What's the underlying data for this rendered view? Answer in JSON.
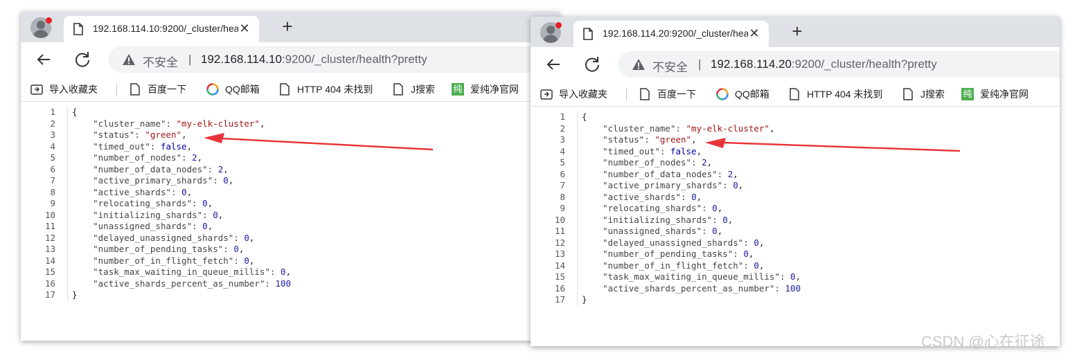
{
  "windows": [
    {
      "tab_title": "192.168.114.10:9200/_cluster/hea",
      "security_label": "不安全",
      "url_host": "192.168.114.10",
      "url_rest": ":9200/_cluster/health?pretty",
      "bookmarks": [
        "导入收藏夹",
        "百度一下",
        "QQ邮箱",
        "HTTP 404 未找到",
        "J搜索",
        "爱纯净官网"
      ],
      "json_lines": [
        {
          "n": "1",
          "pre": "{"
        },
        {
          "n": "2",
          "key": "cluster_name",
          "val": "\"my-elk-cluster\"",
          "vt": "s",
          "tail": ","
        },
        {
          "n": "3",
          "key": "status",
          "val": "\"green\"",
          "vt": "s",
          "tail": ","
        },
        {
          "n": "4",
          "key": "timed_out",
          "val": "false",
          "vt": "b",
          "tail": ","
        },
        {
          "n": "5",
          "key": "number_of_nodes",
          "val": "2",
          "vt": "n",
          "tail": ","
        },
        {
          "n": "6",
          "key": "number_of_data_nodes",
          "val": "2",
          "vt": "n",
          "tail": ","
        },
        {
          "n": "7",
          "key": "active_primary_shards",
          "val": "0",
          "vt": "n",
          "tail": ","
        },
        {
          "n": "8",
          "key": "active_shards",
          "val": "0",
          "vt": "n",
          "tail": ","
        },
        {
          "n": "9",
          "key": "relocating_shards",
          "val": "0",
          "vt": "n",
          "tail": ","
        },
        {
          "n": "10",
          "key": "initializing_shards",
          "val": "0",
          "vt": "n",
          "tail": ","
        },
        {
          "n": "11",
          "key": "unassigned_shards",
          "val": "0",
          "vt": "n",
          "tail": ","
        },
        {
          "n": "12",
          "key": "delayed_unassigned_shards",
          "val": "0",
          "vt": "n",
          "tail": ","
        },
        {
          "n": "13",
          "key": "number_of_pending_tasks",
          "val": "0",
          "vt": "n",
          "tail": ","
        },
        {
          "n": "14",
          "key": "number_of_in_flight_fetch",
          "val": "0",
          "vt": "n",
          "tail": ","
        },
        {
          "n": "15",
          "key": "task_max_waiting_in_queue_millis",
          "val": "0",
          "vt": "n",
          "tail": ","
        },
        {
          "n": "16",
          "key": "active_shards_percent_as_number",
          "val": "100",
          "vt": "n",
          "tail": ""
        },
        {
          "n": "17",
          "pre": "}"
        }
      ]
    },
    {
      "tab_title": "192.168.114.20:9200/_cluster/hea",
      "security_label": "不安全",
      "url_host": "192.168.114.20",
      "url_rest": ":9200/_cluster/health?pretty",
      "bookmarks": [
        "导入收藏夹",
        "百度一下",
        "QQ邮箱",
        "HTTP 404 未找到",
        "J搜索",
        "爱纯净官网"
      ],
      "json_lines": [
        {
          "n": "1",
          "pre": "{"
        },
        {
          "n": "2",
          "key": "cluster_name",
          "val": "\"my-elk-cluster\"",
          "vt": "s",
          "tail": ","
        },
        {
          "n": "3",
          "key": "status",
          "val": "\"green\"",
          "vt": "s",
          "tail": ","
        },
        {
          "n": "4",
          "key": "timed_out",
          "val": "false",
          "vt": "b",
          "tail": ","
        },
        {
          "n": "5",
          "key": "number_of_nodes",
          "val": "2",
          "vt": "n",
          "tail": ","
        },
        {
          "n": "6",
          "key": "number_of_data_nodes",
          "val": "2",
          "vt": "n",
          "tail": ","
        },
        {
          "n": "7",
          "key": "active_primary_shards",
          "val": "0",
          "vt": "n",
          "tail": ","
        },
        {
          "n": "8",
          "key": "active_shards",
          "val": "0",
          "vt": "n",
          "tail": ","
        },
        {
          "n": "9",
          "key": "relocating_shards",
          "val": "0",
          "vt": "n",
          "tail": ","
        },
        {
          "n": "10",
          "key": "initializing_shards",
          "val": "0",
          "vt": "n",
          "tail": ","
        },
        {
          "n": "11",
          "key": "unassigned_shards",
          "val": "0",
          "vt": "n",
          "tail": ","
        },
        {
          "n": "12",
          "key": "delayed_unassigned_shards",
          "val": "0",
          "vt": "n",
          "tail": ","
        },
        {
          "n": "13",
          "key": "number_of_pending_tasks",
          "val": "0",
          "vt": "n",
          "tail": ","
        },
        {
          "n": "14",
          "key": "number_of_in_flight_fetch",
          "val": "0",
          "vt": "n",
          "tail": ","
        },
        {
          "n": "15",
          "key": "task_max_waiting_in_queue_millis",
          "val": "0",
          "vt": "n",
          "tail": ","
        },
        {
          "n": "16",
          "key": "active_shards_percent_as_number",
          "val": "100",
          "vt": "n",
          "tail": ""
        },
        {
          "n": "17",
          "pre": "}"
        }
      ]
    }
  ],
  "watermark": "CSDN @心在征途",
  "colors": {
    "annotation_arrow": "#e8363a",
    "json_string": "#a31515",
    "json_number": "#1a1aa6"
  }
}
